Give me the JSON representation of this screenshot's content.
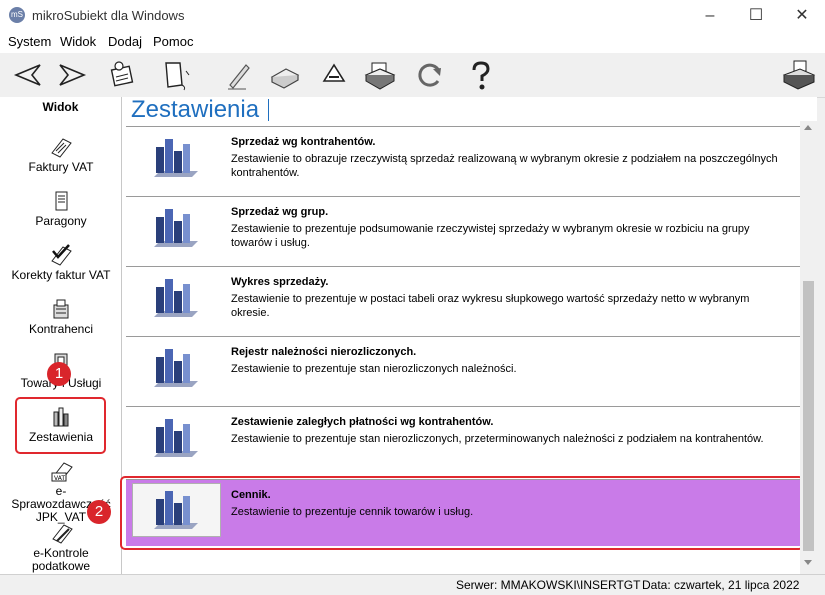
{
  "window": {
    "title": "mikroSubiekt dla Windows",
    "minimize": "–",
    "maximize": "☐",
    "close": "✕",
    "app_icon": "mS"
  },
  "menu": [
    "System",
    "Widok",
    "Dodaj",
    "Pomoc"
  ],
  "toolbar_icons": [
    "back-arrow-icon",
    "forward-arrow-icon",
    "calendar-icon",
    "document-curl-icon",
    "pen-icon",
    "printer-icon",
    "recycle-icon",
    "printer-large-icon",
    "refresh-icon",
    "help-question-icon",
    "fax-printer-icon"
  ],
  "sidebar": {
    "header": "Widok",
    "items": [
      {
        "label": "Faktury VAT"
      },
      {
        "label": "Paragony"
      },
      {
        "label": "Korekty faktur VAT"
      },
      {
        "label": "Kontrahenci"
      },
      {
        "label": "Towary i Usługi"
      },
      {
        "label": "Zestawienia"
      },
      {
        "label": "e-Sprawozdawczość JPK_VAT"
      },
      {
        "label": "e-Kontrole podatkowe"
      }
    ]
  },
  "main": {
    "title": "Zestawienia",
    "reports": [
      {
        "name": "Sprzedaż wg kontrahentów.",
        "desc": "Zestawienie to obrazuje rzeczywistą sprzedaż realizowaną w wybranym okresie z podziałem na poszczególnych kontrahentów."
      },
      {
        "name": "Sprzedaż wg grup.",
        "desc": "Zestawienie to prezentuje podsumowanie rzeczywistej sprzedaży w wybranym okresie w rozbiciu na grupy towarów i usług."
      },
      {
        "name": "Wykres sprzedaży.",
        "desc": "Zestawienie to prezentuje w postaci tabeli oraz wykresu słupkowego wartość sprzedaży netto w wybranym okresie."
      },
      {
        "name": "Rejestr należności nierozliczonych.",
        "desc": "Zestawienie to prezentuje stan nierozliczonych należności."
      },
      {
        "name": "Zestawienie zaległych płatności wg kontrahentów.",
        "desc": "Zestawienie to prezentuje stan nierozliczonych, przeterminowanych należności z podziałem na kontrahentów."
      },
      {
        "name": "Cennik.",
        "desc": "Zestawienie to prezentuje cennik towarów i usług."
      }
    ]
  },
  "status": {
    "server": "Serwer: MMAKOWSKI\\INSERTGT",
    "date": "Data: czwartek, 21 lipca 2022"
  },
  "badges": [
    "1",
    "2"
  ],
  "colors": {
    "accent_title": "#1f6fbf",
    "selected_row": "#c97be8",
    "highlight": "#e0282e"
  }
}
